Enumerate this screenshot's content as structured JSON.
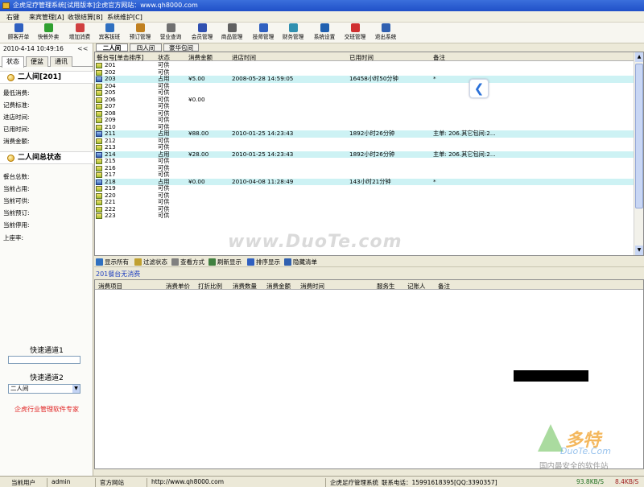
{
  "window": {
    "title": "企虎足疗管理系统[试用版本]企虎官方网站：www.qh8000.com"
  },
  "menu": [
    "右键",
    "来宾管理[A]",
    "收银结算[B]",
    "系统维护[C]"
  ],
  "toolbar": [
    {
      "label": "顾客开单",
      "icon": "open-order-icon",
      "color": "#3060c0"
    },
    {
      "label": "快餐外卖",
      "icon": "takeout-icon",
      "color": "#30a030"
    },
    {
      "label": "增加消费",
      "icon": "add-consume-icon",
      "color": "#d04040"
    },
    {
      "label": "宾客拔班",
      "icon": "speaker-icon",
      "color": "#3070c0"
    },
    {
      "label": "预订管理",
      "icon": "booking-icon",
      "color": "#c08020"
    },
    {
      "label": "营业查询",
      "icon": "printer-icon",
      "color": "#707070"
    },
    {
      "label": "会员管理",
      "icon": "save-icon",
      "color": "#3050b0"
    },
    {
      "label": "商品管理",
      "icon": "goods-icon",
      "color": "#606060"
    },
    {
      "label": "技师管理",
      "icon": "help-icon",
      "color": "#3060c0"
    },
    {
      "label": "财务管理",
      "icon": "finance-icon",
      "color": "#3090b0"
    },
    {
      "label": "系统设置",
      "icon": "settings-icon",
      "color": "#2060b0"
    },
    {
      "label": "交班管理",
      "icon": "shift-icon",
      "color": "#d03030"
    },
    {
      "label": "退出系统",
      "icon": "exit-icon",
      "color": "#3060b0"
    }
  ],
  "sidebar": {
    "datetime": "2010-4-14 10:49:16",
    "collapse": "<<",
    "tabs": [
      "状态",
      "便盆",
      "通讯"
    ],
    "room_section": {
      "title": "二人间[201]",
      "rows": [
        "最低消费:",
        "记费标准:",
        "进店时间:",
        "已用时间:",
        "消费金额:"
      ]
    },
    "total_section": {
      "title": "二人间总状态",
      "rows": [
        "餐台总数:",
        "当前占用:",
        "当前可供:",
        "当前预订:",
        "当前停用:",
        "上座率:"
      ]
    },
    "quick1": "快速通道1",
    "quick2": "快速通道2",
    "quick2_value": "二人间",
    "tagline": "企虎行业管理软件专家"
  },
  "room_tabs": [
    "二人间",
    "四人间",
    "豪华包间"
  ],
  "grid": {
    "headers": [
      "餐台号[单击排序]",
      "状态",
      "消费金额",
      "进店时间",
      "已用时间",
      "备注"
    ],
    "rows": [
      {
        "no": "201",
        "status": "可供",
        "amount": "",
        "in": "",
        "used": "",
        "note": "",
        "occ": false
      },
      {
        "no": "202",
        "status": "可供",
        "amount": "",
        "in": "",
        "used": "",
        "note": "",
        "occ": false
      },
      {
        "no": "203",
        "status": "占用",
        "amount": "¥5.00",
        "in": "2008-05-28 14:59:05",
        "used": "16458小时50分钟",
        "note": "*",
        "occ": true
      },
      {
        "no": "204",
        "status": "可供",
        "amount": "",
        "in": "",
        "used": "",
        "note": "",
        "occ": false
      },
      {
        "no": "205",
        "status": "可供",
        "amount": "",
        "in": "",
        "used": "",
        "note": "",
        "occ": false
      },
      {
        "no": "206",
        "status": "可供",
        "amount": "¥0.00",
        "in": "",
        "used": "",
        "note": "",
        "occ": false
      },
      {
        "no": "207",
        "status": "可供",
        "amount": "",
        "in": "",
        "used": "",
        "note": "",
        "occ": false
      },
      {
        "no": "208",
        "status": "可供",
        "amount": "",
        "in": "",
        "used": "",
        "note": "",
        "occ": false
      },
      {
        "no": "209",
        "status": "可供",
        "amount": "",
        "in": "",
        "used": "",
        "note": "",
        "occ": false
      },
      {
        "no": "210",
        "status": "可供",
        "amount": "",
        "in": "",
        "used": "",
        "note": "",
        "occ": false
      },
      {
        "no": "211",
        "status": "占用",
        "amount": "¥88.00",
        "in": "2010-01-25 14:23:43",
        "used": "1892小时26分钟",
        "note": "主单: 206.其它包间:2...",
        "occ": true
      },
      {
        "no": "212",
        "status": "可供",
        "amount": "",
        "in": "",
        "used": "",
        "note": "",
        "occ": false
      },
      {
        "no": "213",
        "status": "可供",
        "amount": "",
        "in": "",
        "used": "",
        "note": "",
        "occ": false
      },
      {
        "no": "214",
        "status": "占用",
        "amount": "¥28.00",
        "in": "2010-01-25 14:23:43",
        "used": "1892小时26分钟",
        "note": "主单: 206.其它包间:2...",
        "occ": true
      },
      {
        "no": "215",
        "status": "可供",
        "amount": "",
        "in": "",
        "used": "",
        "note": "",
        "occ": false
      },
      {
        "no": "216",
        "status": "可供",
        "amount": "",
        "in": "",
        "used": "",
        "note": "",
        "occ": false
      },
      {
        "no": "217",
        "status": "可供",
        "amount": "",
        "in": "",
        "used": "",
        "note": "",
        "occ": false
      },
      {
        "no": "218",
        "status": "占用",
        "amount": "¥0.00",
        "in": "2010-04-08 11:28:49",
        "used": "143小时21分钟",
        "note": "*",
        "occ": true
      },
      {
        "no": "219",
        "status": "可供",
        "amount": "",
        "in": "",
        "used": "",
        "note": "",
        "occ": false
      },
      {
        "no": "220",
        "status": "可供",
        "amount": "",
        "in": "",
        "used": "",
        "note": "",
        "occ": false
      },
      {
        "no": "221",
        "status": "可供",
        "amount": "",
        "in": "",
        "used": "",
        "note": "",
        "occ": false
      },
      {
        "no": "222",
        "status": "可供",
        "amount": "",
        "in": "",
        "used": "",
        "note": "",
        "occ": false
      },
      {
        "no": "223",
        "status": "可供",
        "amount": "",
        "in": "",
        "used": "",
        "note": "",
        "occ": false
      }
    ]
  },
  "watermark": "www.DuoTe.com",
  "actions": [
    {
      "label": "显示所有",
      "color": "#3070c0"
    },
    {
      "label": "过滤状态",
      "color": "#c0a030"
    },
    {
      "label": "查看方式",
      "color": "#808080"
    },
    {
      "label": "刷新显示",
      "color": "#408040"
    },
    {
      "label": "排序显示",
      "color": "#3060c0"
    },
    {
      "label": "隐藏清单",
      "color": "#3060b0"
    }
  ],
  "status_message": "201餐台无消费",
  "detail": {
    "headers": [
      "消费项目",
      "消费单价",
      "打折比例",
      "消费数量",
      "消费金额",
      "消费时间",
      "服务生",
      "记账人",
      "备注"
    ]
  },
  "logo": {
    "big": "多特",
    "mid": "DuoTe.Com",
    "small": "国内最安全的软件站",
    "side": "软件站"
  },
  "statusbar": {
    "user_label": "当前用户",
    "user": "admin",
    "site_label": "官方网站",
    "site": "http://www.qh8000.com",
    "product": "企虎足疗管理系统",
    "phone": "联系电话：15991618395[QQ:3390357]",
    "down": "93.8KB/S",
    "up": "8.4KB/S"
  }
}
